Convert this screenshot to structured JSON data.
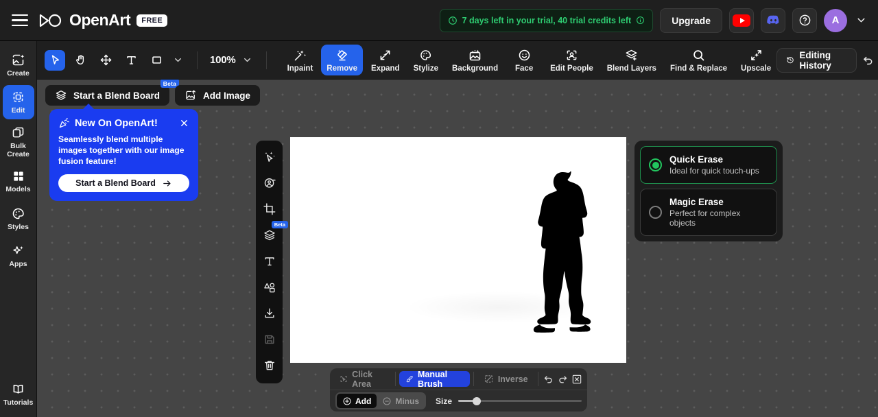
{
  "header": {
    "menu_icon": "hamburger-icon",
    "brand": "OpenArt",
    "plan_badge": "FREE",
    "trial_text": "7 days left in your trial,  40 trial credits left",
    "trial_color": "#2ecc71",
    "upgrade_label": "Upgrade",
    "youtube_icon": "youtube-icon",
    "discord_icon": "discord-icon",
    "help_icon": "help-circle-icon",
    "avatar_initial": "A",
    "avatar_color": "#9b6ee0",
    "account_caret": "chevron-down-icon"
  },
  "sidebar": {
    "items": [
      {
        "label": "Create",
        "icon": "magic-image-icon",
        "active": false
      },
      {
        "label": "Edit",
        "icon": "crop-select-icon",
        "active": true
      },
      {
        "label": "Bulk\nCreate",
        "line1": "Bulk",
        "line2": "Create",
        "icon": "copy-stack-icon",
        "active": false
      },
      {
        "label": "Models",
        "icon": "grid-four-icon",
        "active": false
      },
      {
        "label": "Styles",
        "icon": "palette-icon",
        "active": false
      },
      {
        "label": "Apps",
        "icon": "sparkles-icon",
        "active": false
      }
    ],
    "bottom": {
      "label": "Tutorials",
      "icon": "book-open-icon"
    }
  },
  "toolbar": {
    "cursor_icon": "cursor-arrow-icon",
    "hand_icon": "hand-icon",
    "move_icon": "move-arrows-icon",
    "text_icon": "text-t-icon",
    "shape_icon": "square-shape-icon",
    "shape_caret": "chevron-down-icon",
    "zoom_value": "100%",
    "zoom_caret": "chevron-down-icon",
    "tools": [
      {
        "label": "Inpaint",
        "icon": "inpaint-wand-icon",
        "active": false
      },
      {
        "label": "Remove",
        "icon": "remove-eraser-icon",
        "active": true
      },
      {
        "label": "Expand",
        "icon": "expand-arrows-icon",
        "active": false
      },
      {
        "label": "Stylize",
        "icon": "stylize-palette-icon",
        "active": false
      },
      {
        "label": "Background",
        "icon": "background-image-icon",
        "active": false
      },
      {
        "label": "Face",
        "icon": "face-smile-icon",
        "active": false
      },
      {
        "label": "Edit People",
        "icon": "edit-people-icon",
        "active": false
      },
      {
        "label": "Blend Layers",
        "icon": "blend-layers-icon",
        "active": false
      },
      {
        "label": "Find & Replace",
        "icon": "search-icon",
        "active": false
      },
      {
        "label": "Upscale",
        "icon": "upscale-sparkle-icon",
        "active": false
      }
    ],
    "history_label": "Editing History",
    "history_icon": "clock-rewind-icon",
    "undo_icon": "undo-arrow-icon",
    "redo_icon": "redo-arrow-icon"
  },
  "blendbar": {
    "start_board_label": "Start a Blend Board",
    "start_board_icon": "layers-icon",
    "beta_badge": "Beta",
    "add_image_label": "Add Image",
    "add_image_icon": "image-upload-icon"
  },
  "popup": {
    "title": "New On OpenArt!",
    "title_icon": "confetti-icon",
    "close_icon": "close-x-icon",
    "body": "Seamlessly blend multiple images together with our image fusion feature!",
    "cta_label": "Start a Blend Board",
    "cta_icon": "arrow-right-icon",
    "accent": "#1a3cf0"
  },
  "vertical_rail": {
    "items": [
      {
        "icon": "magic-select-icon",
        "dim": false,
        "badge": ""
      },
      {
        "icon": "face-retouch-icon",
        "dim": false,
        "badge": ""
      },
      {
        "icon": "crop-icon",
        "dim": false,
        "badge": ""
      },
      {
        "icon": "layers-icon",
        "dim": false,
        "badge": "Beta"
      },
      {
        "icon": "text-t-icon",
        "dim": false,
        "badge": ""
      },
      {
        "icon": "shapes-icon",
        "dim": false,
        "badge": ""
      },
      {
        "icon": "download-icon",
        "dim": false,
        "badge": ""
      },
      {
        "icon": "save-disk-icon",
        "dim": true,
        "badge": ""
      },
      {
        "icon": "trash-icon",
        "dim": false,
        "badge": ""
      }
    ]
  },
  "erase_panel": {
    "options": [
      {
        "title": "Quick Erase",
        "subtitle": "Ideal for quick touch-ups",
        "selected": true
      },
      {
        "title": "Magic Erase",
        "subtitle": "Perfect for complex objects",
        "selected": false
      }
    ],
    "selected_color": "#22c55e"
  },
  "brushbar": {
    "modes": [
      {
        "label": "Click Area",
        "icon": "click-area-icon",
        "active": false
      },
      {
        "label": "Manual Brush",
        "icon": "brush-icon",
        "active": true
      },
      {
        "label": "Inverse",
        "icon": "inverse-select-icon",
        "active": false
      }
    ],
    "undo_icon": "undo-arrow-icon",
    "redo_icon": "redo-arrow-icon",
    "clear_icon": "clear-selection-icon",
    "add_label": "Add",
    "add_icon": "plus-circle-icon",
    "minus_label": "Minus",
    "minus_icon": "minus-circle-icon",
    "size_label": "Size",
    "size_percent": 15
  },
  "canvas": {
    "content": "white image with black silhouette of a standing man",
    "background": "#ffffff"
  }
}
